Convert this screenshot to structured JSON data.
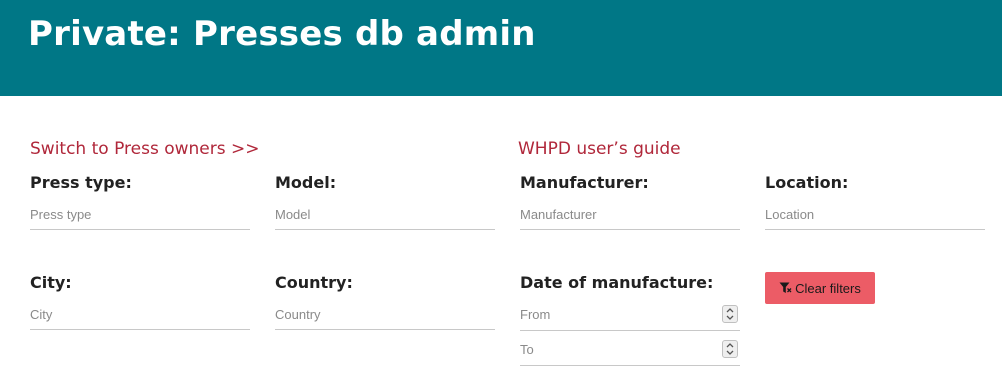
{
  "header": {
    "title": "Private: Presses db admin"
  },
  "links": {
    "switch_owners": "Switch to Press owners >>",
    "user_guide": "WHPD user’s guide"
  },
  "filters": {
    "press_type": {
      "label": "Press type:",
      "placeholder": "Press type"
    },
    "model": {
      "label": "Model:",
      "placeholder": "Model"
    },
    "manufacturer": {
      "label": "Manufacturer:",
      "placeholder": "Manufacturer"
    },
    "location": {
      "label": "Location:",
      "placeholder": "Location"
    },
    "city": {
      "label": "City:",
      "placeholder": "City"
    },
    "country": {
      "label": "Country:",
      "placeholder": "Country"
    },
    "date": {
      "label": "Date of manufacture:",
      "from_placeholder": "From",
      "to_placeholder": "To"
    }
  },
  "actions": {
    "clear_filters": "Clear filters",
    "clear_icon": "filter-clear-icon"
  },
  "colors": {
    "header_bg": "#007786",
    "link": "#b0273a",
    "clear_button": "#ec5c66"
  }
}
